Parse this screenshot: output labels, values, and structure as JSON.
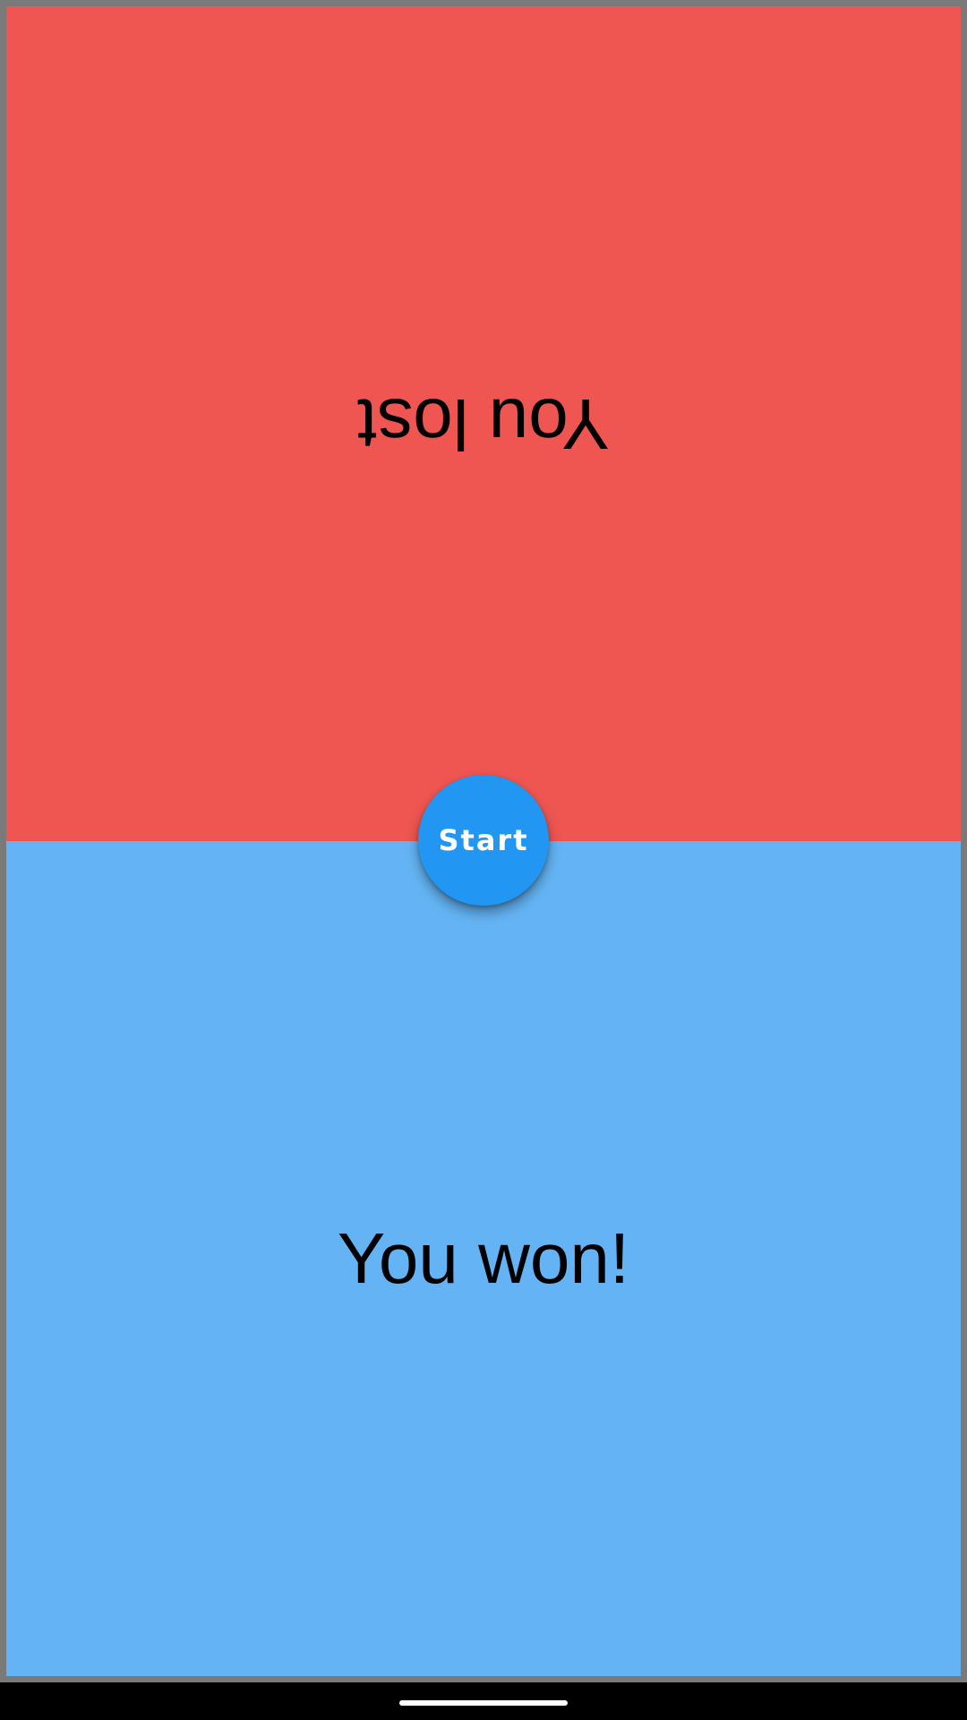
{
  "top_panel": {
    "text": "You lost",
    "background_color": "#ef5651"
  },
  "bottom_panel": {
    "text": "You won!",
    "background_color": "#64b4f5"
  },
  "start_button": {
    "label": "Start",
    "background_color": "#2196f3"
  },
  "navigation": {
    "home_indicator": "home-indicator"
  }
}
